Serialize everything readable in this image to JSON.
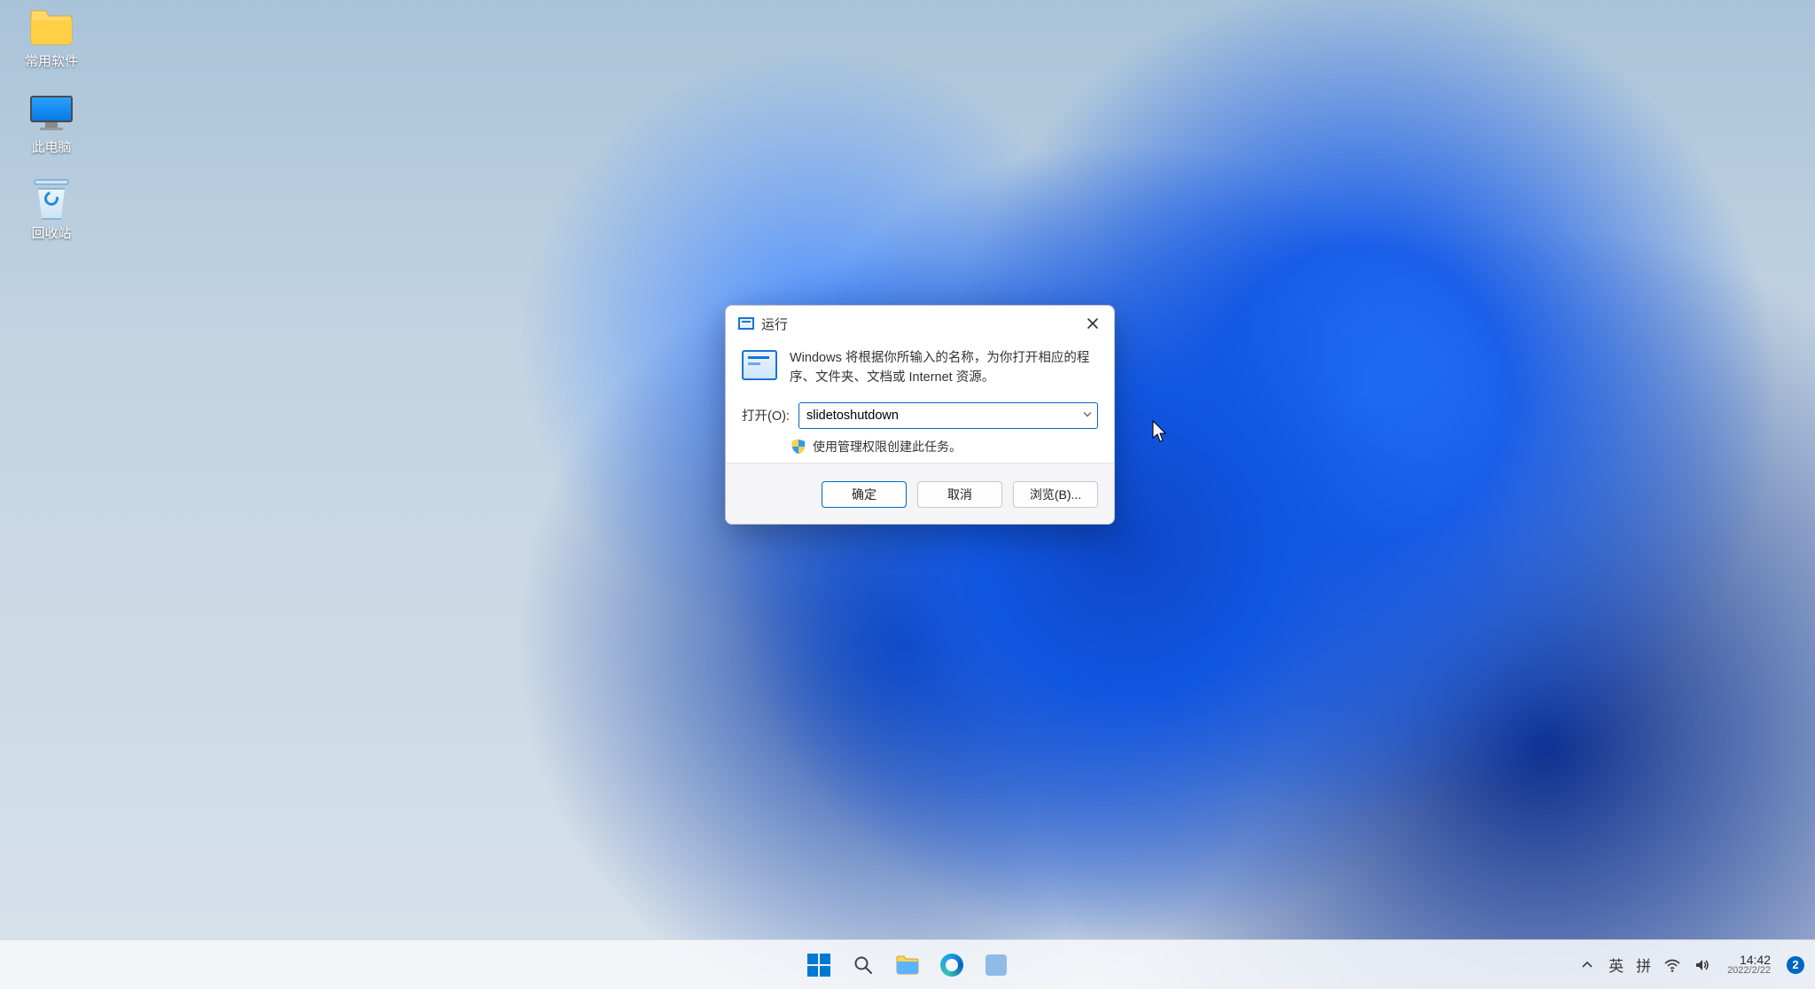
{
  "desktop": {
    "icons": [
      {
        "name": "folder-common-software",
        "label": "常用软件"
      },
      {
        "name": "this-pc",
        "label": "此电脑"
      },
      {
        "name": "recycle-bin",
        "label": "回收站"
      }
    ]
  },
  "run_dialog": {
    "title": "运行",
    "description": "Windows 将根据你所输入的名称，为你打开相应的程序、文件夹、文档或 Internet 资源。",
    "open_label": "打开(O):",
    "open_value": "slidetoshutdown",
    "admin_note": "使用管理权限创建此任务。",
    "buttons": {
      "ok": "确定",
      "cancel": "取消",
      "browse": "浏览(B)..."
    }
  },
  "taskbar": {
    "center_items": [
      {
        "name": "start",
        "icon": "windows-logo-icon"
      },
      {
        "name": "search",
        "icon": "search-icon"
      },
      {
        "name": "file-explorer",
        "icon": "folder-icon"
      },
      {
        "name": "edge",
        "icon": "edge-icon"
      },
      {
        "name": "app-generic",
        "icon": "app-icon"
      }
    ],
    "tray": {
      "overflow_icon": "chevron-up-icon",
      "ime_lang": "英",
      "ime_mode": "拼",
      "wifi_icon": "wifi-icon",
      "volume_icon": "volume-icon",
      "time": "14:42",
      "date": "2022/2/22",
      "notification_count": "2"
    }
  }
}
